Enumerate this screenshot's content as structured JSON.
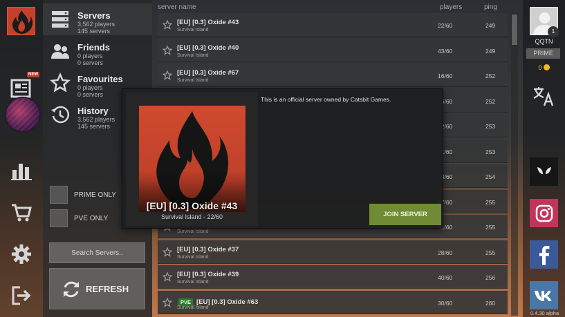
{
  "categories": [
    {
      "title": "Servers",
      "line1": "3,562 players",
      "line2": "145 servers"
    },
    {
      "title": "Friends",
      "line1": "0 players",
      "line2": "0 servers"
    },
    {
      "title": "Favourites",
      "line1": "0 players",
      "line2": "0 servers"
    },
    {
      "title": "History",
      "line1": "3,562 players",
      "line2": "145 servers"
    }
  ],
  "nav": {
    "new_badge": "NEW"
  },
  "filters": {
    "prime_only": "PRIME ONLY",
    "pve_only": "PVE ONLY"
  },
  "search": {
    "placeholder": "Search Servers.."
  },
  "refresh": {
    "label": "REFRESH"
  },
  "list_header": {
    "name": "server name",
    "players": "players",
    "ping": "ping"
  },
  "servers": [
    {
      "name": "[EU] [0.3] Oxide #43",
      "map": "Survival Island",
      "players": "22/60",
      "ping": "249"
    },
    {
      "name": "[EU] [0.3] Oxide #40",
      "map": "Survival Island",
      "players": "43/60",
      "ping": "249"
    },
    {
      "name": "[EU] [0.3] Oxide #67",
      "map": "Survival Island",
      "players": "16/60",
      "ping": "252"
    },
    {
      "name": "",
      "map": "",
      "players": "26/60",
      "ping": "252"
    },
    {
      "name": "",
      "map": "",
      "players": "32/60",
      "ping": "253"
    },
    {
      "name": "",
      "map": "",
      "players": "21/60",
      "ping": "253"
    },
    {
      "name": "",
      "map": "",
      "players": "38/60",
      "ping": "254"
    },
    {
      "name": "",
      "map": "",
      "players": "17/60",
      "ping": "255"
    },
    {
      "name": "",
      "map": "Survival Island",
      "players": "41/60",
      "ping": "255"
    },
    {
      "name": "[EU] [0.3] Oxide #37",
      "map": "Survival Island",
      "players": "28/60",
      "ping": "255"
    },
    {
      "name": "[EU] [0.3] Oxide #39",
      "map": "Survival Island",
      "players": "40/60",
      "ping": "256"
    },
    {
      "name": "[EU] [0.3] Oxide #63",
      "map": "Survival Island",
      "players": "30/60",
      "ping": "260",
      "tag": "PVE"
    }
  ],
  "popup": {
    "title": "[EU] [0.3] Oxide #43",
    "subtitle": "Survival Island - 22/60",
    "description": "This is an official server owned by Catsbit Games.",
    "join_label": "JOIN SERVER"
  },
  "user": {
    "name": "QQTN",
    "level": "1",
    "prime_label": "PRIME",
    "coins": "0"
  },
  "version": "0.4.30 alpha",
  "colors": {
    "accent_red": "#c4402a",
    "join_green": "#6f8b35",
    "pve_green": "#2d7a32",
    "facebook": "#3b5998",
    "vk": "#4a76a8",
    "instagram": "#c1355a"
  }
}
